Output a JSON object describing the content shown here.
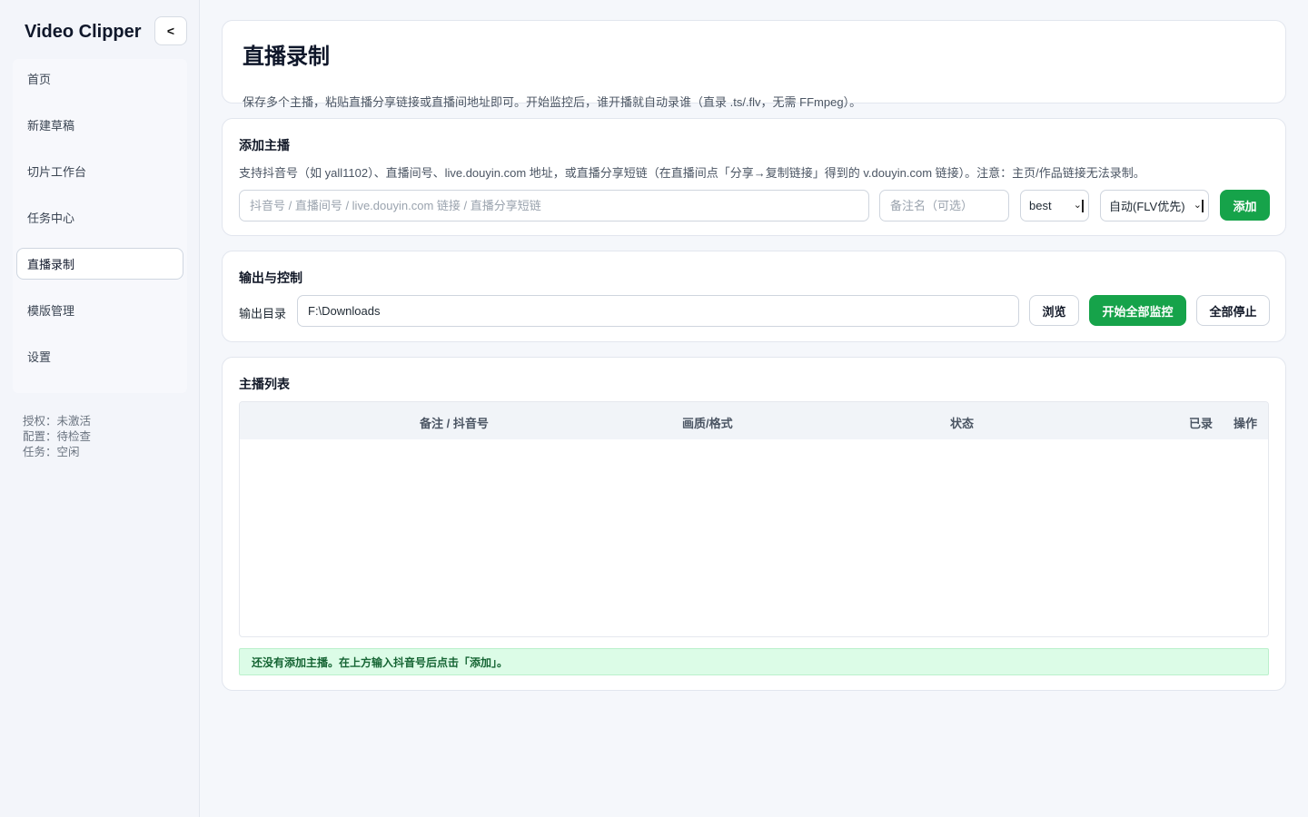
{
  "app": {
    "brand": "Video Clipper",
    "collapse_label": "<"
  },
  "sidebar": {
    "items": [
      {
        "label": "首页"
      },
      {
        "label": "新建草稿"
      },
      {
        "label": "切片工作台"
      },
      {
        "label": "任务中心"
      },
      {
        "label": "直播录制",
        "active": true
      },
      {
        "label": "模版管理"
      },
      {
        "label": "设置"
      }
    ],
    "status": {
      "license": "授权：未激活",
      "config": "配置：待检查",
      "task": "任务：空闲"
    }
  },
  "header": {
    "title": "直播录制",
    "description": "保存多个主播，粘贴直播分享链接或直播间地址即可。开始监控后，谁开播就自动录谁（直录 .ts/.flv，无需 FFmpeg）。"
  },
  "add_streamer": {
    "title": "添加主播",
    "hint": "支持抖音号（如 yall1102）、直播间号、live.douyin.com 地址，或直播分享短链（在直播间点「分享→复制链接」得到的 v.douyin.com 链接）。注意：主页/作品链接无法录制。",
    "url_input": {
      "value": "",
      "placeholder": "抖音号 / 直播间号 / live.douyin.com 链接 / 直播分享短链"
    },
    "note_input": {
      "value": "",
      "placeholder": "备注名（可选）"
    },
    "quality_select": {
      "value": "best"
    },
    "format_select": {
      "value": "自动(FLV优先)"
    },
    "add_button": "添加"
  },
  "output": {
    "title": "输出与控制",
    "dir_label": "输出目录",
    "dir_value": "F:\\Downloads",
    "browse_button": "浏览",
    "start_all_button": "开始全部监控",
    "stop_all_button": "全部停止"
  },
  "list": {
    "title": "主播列表",
    "columns": [
      "备注 / 抖音号",
      "画质/格式",
      "状态",
      "已录",
      "操作"
    ],
    "rows": [],
    "empty_message": "还没有添加主播。在上方输入抖音号后点击「添加」。"
  },
  "colors": {
    "accent": "#16a34a",
    "success_bg": "#dcfce7",
    "success_text": "#166534"
  }
}
